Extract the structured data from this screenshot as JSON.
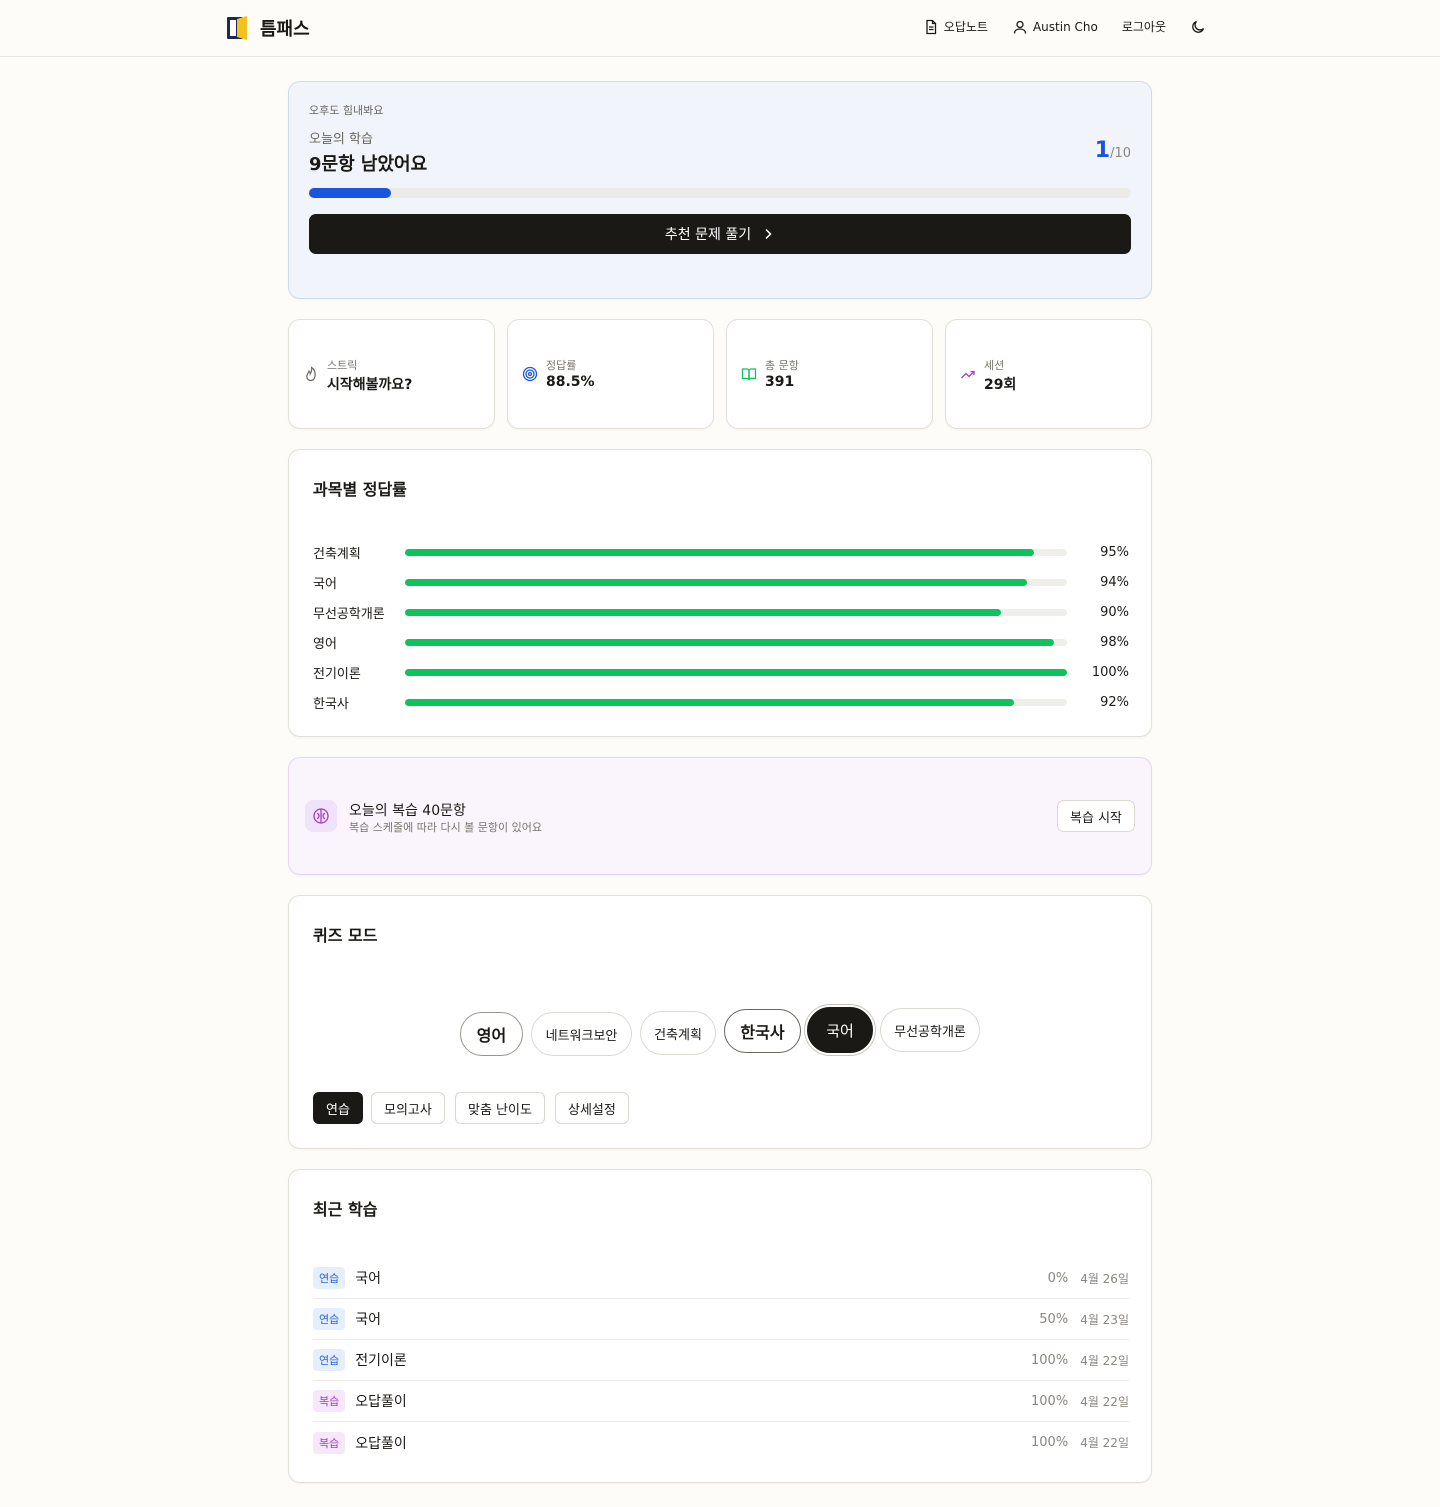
{
  "header": {
    "logo_text": "틈패스",
    "nav": {
      "wrong_notes": "오답노트",
      "user_name": "Austin Cho",
      "logout": "로그아웃"
    }
  },
  "hero": {
    "greeting": "오후도 힘내봐요",
    "subtitle": "오늘의 학습",
    "headline": "9문항 남았어요",
    "count_done": "1",
    "count_total": "/10",
    "progress": 0.1,
    "cta_label": "추천 문제 풀기"
  },
  "stats": [
    {
      "label": "스트릭",
      "value": "시작해볼까요?",
      "icon": "flame-icon"
    },
    {
      "label": "정답률",
      "value": "88.5%",
      "icon": "target-icon"
    },
    {
      "label": "총 문항",
      "value": "391",
      "icon": "book-icon"
    },
    {
      "label": "세션",
      "value": "29회",
      "icon": "trending-up-icon"
    }
  ],
  "subject_accuracy": {
    "title": "과목별 정답률",
    "rows": [
      {
        "name": "건축계획",
        "pct": 95,
        "pct_label": "95%"
      },
      {
        "name": "국어",
        "pct": 94,
        "pct_label": "94%"
      },
      {
        "name": "무선공학개론",
        "pct": 90,
        "pct_label": "90%"
      },
      {
        "name": "영어",
        "pct": 98,
        "pct_label": "98%"
      },
      {
        "name": "전기이론",
        "pct": 100,
        "pct_label": "100%"
      },
      {
        "name": "한국사",
        "pct": 92,
        "pct_label": "92%"
      }
    ]
  },
  "review": {
    "title": "오늘의 복습 40문항",
    "description": "복습 스케줄에 따라 다시 볼 문항이 있어요",
    "button": "복습 시작"
  },
  "quiz_mode": {
    "title": "퀴즈 모드",
    "subjects": [
      "영어",
      "네트워크보안",
      "건축계획",
      "한국사",
      "국어",
      "무선공학개론"
    ],
    "selected_subject": "국어",
    "modes": [
      "연습",
      "모의고사",
      "맞춤 난이도",
      "상세설정"
    ],
    "selected_mode": "연습"
  },
  "recent": {
    "title": "최근 학습",
    "rows": [
      {
        "badge": "연습",
        "name": "국어",
        "pct": "0%",
        "date": "4월 26일"
      },
      {
        "badge": "연습",
        "name": "국어",
        "pct": "50%",
        "date": "4월 23일"
      },
      {
        "badge": "연습",
        "name": "전기이론",
        "pct": "100%",
        "date": "4월 22일"
      },
      {
        "badge": "복습",
        "name": "오답풀이",
        "pct": "100%",
        "date": "4월 22일"
      },
      {
        "badge": "복습",
        "name": "오답풀이",
        "pct": "100%",
        "date": "4월 22일"
      }
    ]
  },
  "colors": {
    "accent_blue": "#1a56db",
    "success_green": "#0cc45a",
    "review_purple": "#a23cc9",
    "dark": "#1b1916"
  }
}
